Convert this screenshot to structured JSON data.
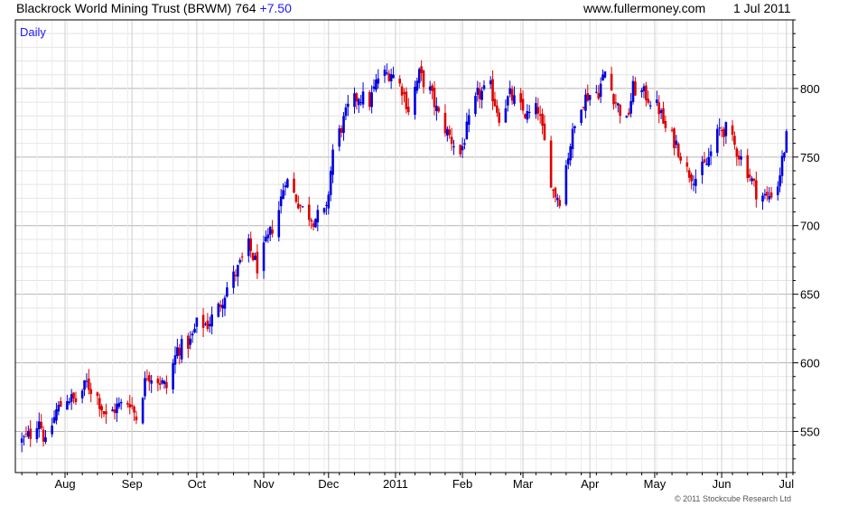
{
  "header": {
    "title": "Blackrock World Mining Trust (BRWM) 764",
    "change": "+7.50",
    "site": "www.fullermoney.com",
    "date": "1 Jul 2011"
  },
  "chart_data": {
    "type": "candlestick",
    "period_label": "Daily",
    "copyright": "© 2011 Stockcube Research Ltd",
    "ylim": [
      520,
      850
    ],
    "y_ticks": [
      550,
      600,
      650,
      700,
      750,
      800
    ],
    "y_tick_labels": [
      "550",
      "600",
      "650",
      "700",
      "750",
      "800"
    ],
    "x_tick_labels": [
      "Aug",
      "Sep",
      "Oct",
      "Nov",
      "Dec",
      "2011",
      "Feb",
      "Mar",
      "Apr",
      "May",
      "Jun",
      "Jul"
    ],
    "x_months": [
      "2010-08",
      "2010-09",
      "2010-10",
      "2010-11",
      "2010-12",
      "2011-01",
      "2011-02",
      "2011-03",
      "2011-04",
      "2011-05",
      "2011-06",
      "2011-07"
    ],
    "x_range": [
      "2010-07-09",
      "2011-07-04"
    ],
    "grid": true,
    "up_color": "#0000dd",
    "down_color": "#dd0000",
    "close_series": [
      [
        "2010-07-12",
        543
      ],
      [
        "2010-07-16",
        548
      ],
      [
        "2010-07-20",
        560
      ],
      [
        "2010-07-23",
        540
      ],
      [
        "2010-07-28",
        565
      ],
      [
        "2010-08-02",
        575
      ],
      [
        "2010-08-06",
        572
      ],
      [
        "2010-08-11",
        585
      ],
      [
        "2010-08-16",
        575
      ],
      [
        "2010-08-20",
        560
      ],
      [
        "2010-08-25",
        568
      ],
      [
        "2010-08-31",
        572
      ],
      [
        "2010-09-03",
        560
      ],
      [
        "2010-09-08",
        592
      ],
      [
        "2010-09-13",
        588
      ],
      [
        "2010-09-17",
        582
      ],
      [
        "2010-09-22",
        610
      ],
      [
        "2010-09-28",
        615
      ],
      [
        "2010-10-01",
        628
      ],
      [
        "2010-10-06",
        628
      ],
      [
        "2010-10-11",
        640
      ],
      [
        "2010-10-15",
        655
      ],
      [
        "2010-10-20",
        668
      ],
      [
        "2010-10-25",
        685
      ],
      [
        "2010-10-29",
        670
      ],
      [
        "2010-11-03",
        690
      ],
      [
        "2010-11-08",
        712
      ],
      [
        "2010-11-11",
        735
      ],
      [
        "2010-11-16",
        720
      ],
      [
        "2010-11-19",
        712
      ],
      [
        "2010-11-24",
        705
      ],
      [
        "2010-11-30",
        710
      ],
      [
        "2010-12-03",
        755
      ],
      [
        "2010-12-07",
        772
      ],
      [
        "2010-12-10",
        785
      ],
      [
        "2010-12-15",
        795
      ],
      [
        "2010-12-20",
        790
      ],
      [
        "2010-12-24",
        808
      ],
      [
        "2010-12-30",
        812
      ],
      [
        "2011-01-04",
        800
      ],
      [
        "2011-01-07",
        785
      ],
      [
        "2011-01-12",
        810
      ],
      [
        "2011-01-17",
        798
      ],
      [
        "2011-01-21",
        780
      ],
      [
        "2011-01-26",
        765
      ],
      [
        "2011-01-31",
        752
      ],
      [
        "2011-02-03",
        770
      ],
      [
        "2011-02-08",
        795
      ],
      [
        "2011-02-14",
        800
      ],
      [
        "2011-02-18",
        780
      ],
      [
        "2011-02-23",
        795
      ],
      [
        "2011-02-28",
        785
      ],
      [
        "2011-03-03",
        780
      ],
      [
        "2011-03-08",
        785
      ],
      [
        "2011-03-11",
        760
      ],
      [
        "2011-03-15",
        725
      ],
      [
        "2011-03-18",
        720
      ],
      [
        "2011-03-23",
        760
      ],
      [
        "2011-03-28",
        790
      ],
      [
        "2011-03-31",
        795
      ],
      [
        "2011-04-05",
        798
      ],
      [
        "2011-04-08",
        812
      ],
      [
        "2011-04-13",
        790
      ],
      [
        "2011-04-18",
        775
      ],
      [
        "2011-04-21",
        800
      ],
      [
        "2011-04-27",
        795
      ],
      [
        "2011-05-03",
        785
      ],
      [
        "2011-05-06",
        770
      ],
      [
        "2011-05-11",
        760
      ],
      [
        "2011-05-16",
        740
      ],
      [
        "2011-05-20",
        735
      ],
      [
        "2011-05-25",
        745
      ],
      [
        "2011-05-31",
        770
      ],
      [
        "2011-06-03",
        770
      ],
      [
        "2011-06-08",
        755
      ],
      [
        "2011-06-13",
        740
      ],
      [
        "2011-06-17",
        725
      ],
      [
        "2011-06-22",
        720
      ],
      [
        "2011-06-27",
        730
      ],
      [
        "2011-06-30",
        756
      ],
      [
        "2011-07-01",
        764
      ]
    ]
  }
}
